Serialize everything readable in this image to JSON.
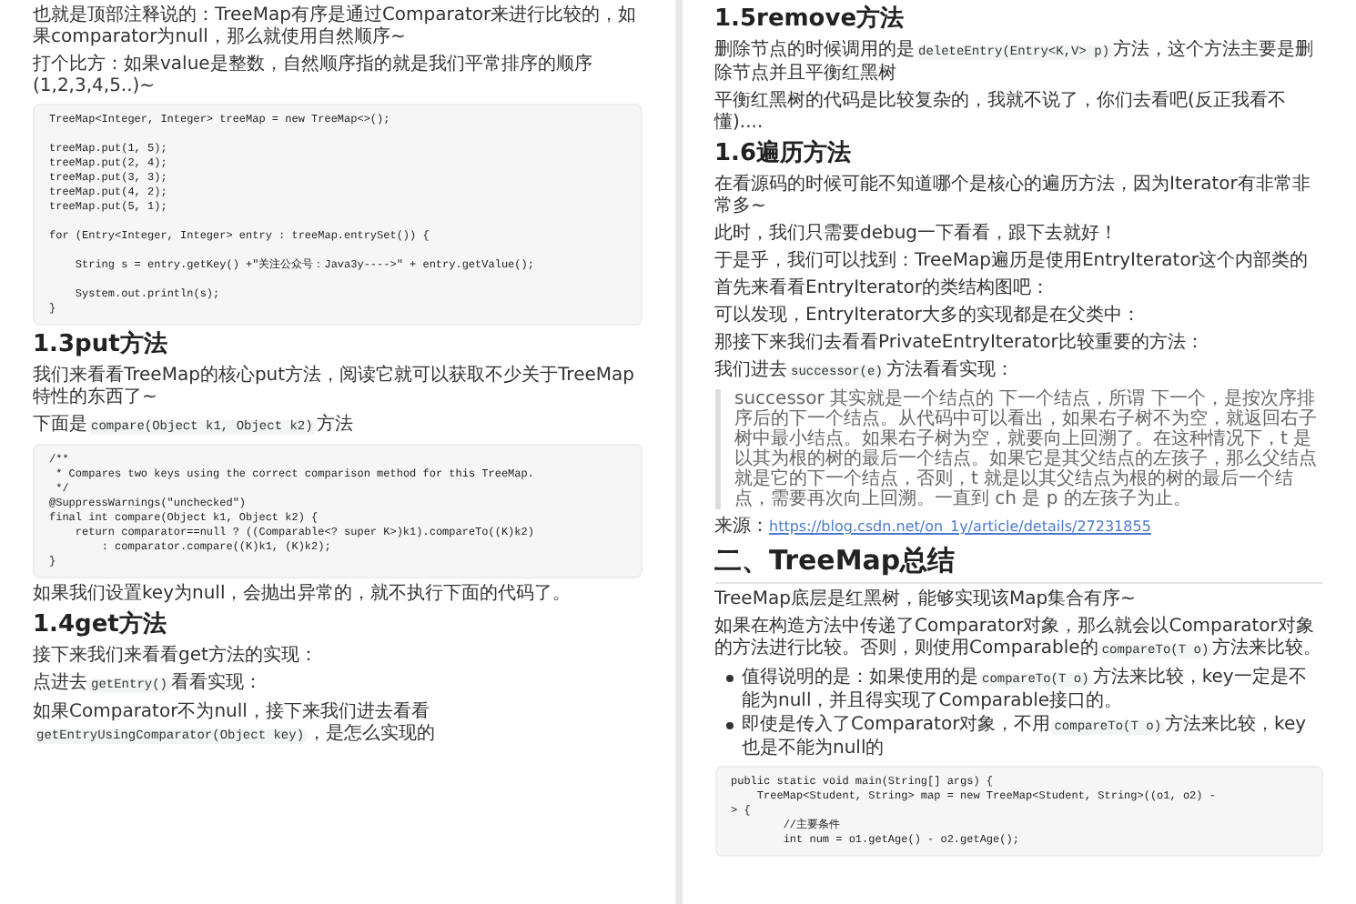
{
  "pages": [
    {
      "blocks": [
        {
          "kind": "para",
          "parts": [
            {
              "kind": "text",
              "text": "也就是顶部注释说的：TreeMap有序是通过Comparator来进行比较的，如果comparator为null，那么就使用自然顺序~"
            }
          ]
        },
        {
          "kind": "para",
          "parts": [
            {
              "kind": "text",
              "text": "打个比方：如果value是整数，自然顺序指的就是我们平常排序的顺序(1,2,3,4,5..)~"
            }
          ]
        },
        {
          "kind": "code",
          "groups": [
            [
              "TreeMap<Integer, Integer> treeMap = new TreeMap<>();"
            ],
            [
              "treeMap.put(1, 5);",
              "treeMap.put(2, 4);",
              "treeMap.put(3, 3);",
              "treeMap.put(4, 2);",
              "treeMap.put(5, 1);"
            ],
            [
              "for (Entry<Integer, Integer> entry : treeMap.entrySet()) {"
            ],
            [
              "    String s = entry.getKey() +\"关注公众号：Java3y---->\" + entry.getValue();"
            ],
            [
              "    System.out.println(s);",
              "}"
            ]
          ]
        },
        {
          "kind": "heading",
          "text": "1.3put方法"
        },
        {
          "kind": "para",
          "parts": [
            {
              "kind": "text",
              "text": "我们来看看TreeMap的核心put方法，阅读它就可以获取不少关于TreeMap特性的东西了~"
            }
          ]
        },
        {
          "kind": "para",
          "parts": [
            {
              "kind": "text",
              "text": "下面是"
            },
            {
              "kind": "code",
              "text": "compare(Object k1, Object k2)"
            },
            {
              "kind": "text",
              "text": "方法"
            }
          ]
        },
        {
          "kind": "code",
          "lines": [
            "/**",
            " * Compares two keys using the correct comparison method for this TreeMap.",
            " */",
            "@SuppressWarnings(\"unchecked\")",
            "final int compare(Object k1, Object k2) {",
            "    return comparator==null ? ((Comparable<? super K>)k1).compareTo((K)k2)",
            "        : comparator.compare((K)k1, (K)k2);",
            "}"
          ]
        },
        {
          "kind": "para",
          "parts": [
            {
              "kind": "text",
              "text": "如果我们设置key为null，会抛出异常的，就不执行下面的代码了。"
            }
          ]
        },
        {
          "kind": "heading",
          "text": "1.4get方法"
        },
        {
          "kind": "para",
          "parts": [
            {
              "kind": "text",
              "text": "接下来我们来看看get方法的实现："
            }
          ]
        },
        {
          "kind": "para",
          "parts": [
            {
              "kind": "text",
              "text": "点进去"
            },
            {
              "kind": "code",
              "text": "getEntry()"
            },
            {
              "kind": "text",
              "text": "看看实现："
            }
          ]
        },
        {
          "kind": "para",
          "parts": [
            {
              "kind": "text",
              "text": "如果Comparator不为null，接下来我们进去看看"
            },
            {
              "kind": "code",
              "text": "getEntryUsingComparator(Object key)"
            },
            {
              "kind": "text",
              "text": "，是怎么实现的"
            }
          ]
        }
      ]
    },
    {
      "blocks": [
        {
          "kind": "heading",
          "text": "1.5remove方法"
        },
        {
          "kind": "para",
          "parts": [
            {
              "kind": "text",
              "text": "删除节点的时候调用的是"
            },
            {
              "kind": "code",
              "text": "deleteEntry(Entry<K,V> p)"
            },
            {
              "kind": "text",
              "text": "方法，这个方法主要是删除节点并且平衡红黑树"
            }
          ]
        },
        {
          "kind": "para",
          "parts": [
            {
              "kind": "text",
              "text": "平衡红黑树的代码是比较复杂的，我就不说了，你们去看吧(反正我看不懂)...."
            }
          ]
        },
        {
          "kind": "heading",
          "text": "1.6遍历方法"
        },
        {
          "kind": "para",
          "parts": [
            {
              "kind": "text",
              "text": "在看源码的时候可能不知道哪个是核心的遍历方法，因为Iterator有非常非常多~"
            }
          ]
        },
        {
          "kind": "para",
          "parts": [
            {
              "kind": "text",
              "text": "此时，我们只需要debug一下看看，跟下去就好！"
            }
          ]
        },
        {
          "kind": "para",
          "parts": [
            {
              "kind": "text",
              "text": "于是乎，我们可以找到：TreeMap遍历是使用EntryIterator这个内部类的"
            }
          ]
        },
        {
          "kind": "para",
          "parts": [
            {
              "kind": "text",
              "text": "首先来看看EntryIterator的类结构图吧："
            }
          ]
        },
        {
          "kind": "para",
          "parts": [
            {
              "kind": "text",
              "text": "可以发现，EntryIterator大多的实现都是在父类中："
            }
          ]
        },
        {
          "kind": "para",
          "parts": [
            {
              "kind": "text",
              "text": "那接下来我们去看看PrivateEntryIterator比较重要的方法："
            }
          ]
        },
        {
          "kind": "para",
          "parts": [
            {
              "kind": "text",
              "text": "我们进去"
            },
            {
              "kind": "code",
              "text": "successor(e)"
            },
            {
              "kind": "text",
              "text": "方法看看实现："
            }
          ]
        },
        {
          "kind": "quote",
          "text": "successor 其实就是一个结点的 下一个结点，所谓 下一个，是按次序排序后的下一个结点。从代码中可以看出，如果右子树不为空，就返回右子树中最小结点。如果右子树为空，就要向上回溯了。在这种情况下，t 是以其为根的树的最后一个结点。如果它是其父结点的左孩子，那么父结点就是它的下一个结点，否则，t 就是以其父结点为根的树的最后一个结点，需要再次向上回溯。一直到 ch 是 p 的左孩子为止。"
        },
        {
          "kind": "source",
          "label": "来源：",
          "link": "https://blog.csdn.net/on_1y/article/details/27231855"
        },
        {
          "kind": "heading2",
          "text": "二、TreeMap总结"
        },
        {
          "kind": "para",
          "parts": [
            {
              "kind": "text",
              "text": "TreeMap底层是红黑树，能够实现该Map集合有序~"
            }
          ]
        },
        {
          "kind": "para",
          "parts": [
            {
              "kind": "text",
              "text": "如果在构造方法中传递了Comparator对象，那么就会以Comparator对象的方法进行比较。否则，则使用Comparable的"
            },
            {
              "kind": "code",
              "text": "compareTo(T o)"
            },
            {
              "kind": "text",
              "text": "方法来比较。"
            }
          ]
        },
        {
          "kind": "bullets",
          "items": [
            [
              {
                "kind": "text",
                "text": "值得说明的是：如果使用的是"
              },
              {
                "kind": "code",
                "text": "compareTo(T o)"
              },
              {
                "kind": "text",
                "text": "方法来比较，key一定是不能为null，并且得实现了Comparable接口的。"
              }
            ],
            [
              {
                "kind": "text",
                "text": "即使是传入了Comparator对象，不用"
              },
              {
                "kind": "code",
                "text": "compareTo(T o)"
              },
              {
                "kind": "text",
                "text": "方法来比较，key也是不能为null的"
              }
            ]
          ]
        },
        {
          "kind": "code",
          "lines": [
            "public static void main(String[] args) {",
            "    TreeMap<Student, String> map = new TreeMap<Student, String>((o1, o2) -",
            "> {",
            "        //主要条件",
            "        int num = o1.getAge() - o2.getAge();"
          ]
        }
      ]
    }
  ]
}
